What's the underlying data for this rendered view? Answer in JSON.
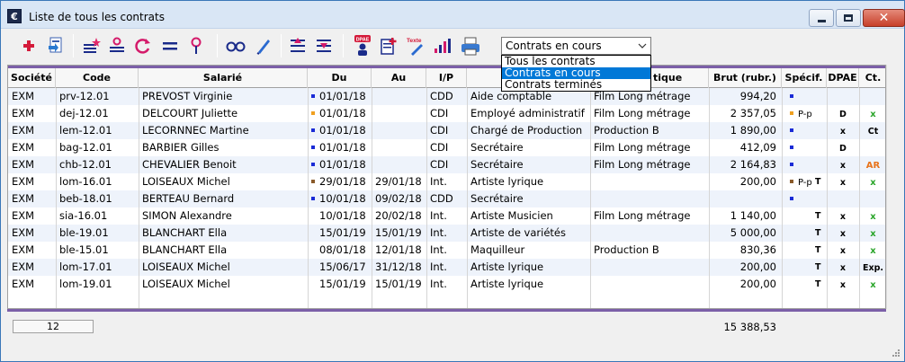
{
  "window": {
    "title": "Liste de tous les contrats",
    "app_icon": "€"
  },
  "filter": {
    "selected": "Contrats en cours",
    "options": [
      "Tous les contrats",
      "Contrats en cours",
      "Contrats terminés"
    ]
  },
  "toolbar": {
    "icons": [
      "add-icon",
      "import-icon",
      "list-star-icon",
      "list-people-icon",
      "refresh-icon",
      "equals-icon",
      "search-key-icon",
      "glasses-icon",
      "pen-icon",
      "sort-up-icon",
      "sort-down-icon",
      "dpae-icon",
      "new-doc-icon",
      "text-icon",
      "chart-icon",
      "print-icon"
    ],
    "dpae_label": "DPAE",
    "texte_label": "Texte"
  },
  "columns": [
    "Société",
    "Code",
    "Salarié",
    "Du",
    "Au",
    "I/P",
    "",
    "tique",
    "Brut (rubr.)",
    "Spécif.",
    "DPAE",
    "Ct."
  ],
  "rows": [
    {
      "societe": "EXM",
      "code": "prv-12.01",
      "salarie": "PREVOST Virginie",
      "mark": "#1a2bd6",
      "du": "01/01/18",
      "au": "",
      "ip": "CDD",
      "emploi": "Aide comptable",
      "prod": "Film Long métrage",
      "brut": "994,20",
      "spec_mark": "#1a2bd6",
      "spec": "",
      "spec_t": "",
      "dpae": "",
      "ct": "",
      "ct_class": ""
    },
    {
      "societe": "EXM",
      "code": "dej-12.01",
      "salarie": "DELCOURT Juliette",
      "mark": "#f0a020",
      "du": "01/01/18",
      "au": "",
      "ip": "CDI",
      "emploi": "Employé administratif",
      "prod": "Film Long métrage",
      "brut": "2 357,05",
      "spec_mark": "#f0a020",
      "spec": "P-p",
      "spec_t": "",
      "dpae": "D",
      "ct": "x",
      "ct_class": "green"
    },
    {
      "societe": "EXM",
      "code": "lem-12.01",
      "salarie": "LECORNNEC Martine",
      "mark": "#1a2bd6",
      "du": "01/01/18",
      "au": "",
      "ip": "CDI",
      "emploi": "Chargé de Production",
      "prod": "Production B",
      "brut": "1 890,00",
      "spec_mark": "#1a2bd6",
      "spec": "",
      "spec_t": "",
      "dpae": "x",
      "ct": "Ct",
      "ct_class": "bold"
    },
    {
      "societe": "EXM",
      "code": "bag-12.01",
      "salarie": "BARBIER Gilles",
      "mark": "#1a2bd6",
      "du": "01/01/18",
      "au": "",
      "ip": "CDI",
      "emploi": "Secrétaire",
      "prod": "Film Long métrage",
      "brut": "412,09",
      "spec_mark": "#1a2bd6",
      "spec": "",
      "spec_t": "",
      "dpae": "D",
      "ct": "",
      "ct_class": ""
    },
    {
      "societe": "EXM",
      "code": "chb-12.01",
      "salarie": "CHEVALIER Benoit",
      "mark": "#1a2bd6",
      "du": "01/01/18",
      "au": "",
      "ip": "CDI",
      "emploi": "Secrétaire",
      "prod": "Film Long métrage",
      "brut": "2 164,83",
      "spec_mark": "#1a2bd6",
      "spec": "",
      "spec_t": "",
      "dpae": "x",
      "ct": "AR",
      "ct_class": "orange"
    },
    {
      "societe": "EXM",
      "code": "lom-16.01",
      "salarie": "LOISEAUX Michel",
      "mark": "#8a5a2a",
      "du": "29/01/18",
      "au": "29/01/18",
      "ip": "Int.",
      "emploi": "Artiste lyrique",
      "prod": "",
      "brut": "200,00",
      "spec_mark": "#8a5a2a",
      "spec": "P-p",
      "spec_t": "T",
      "dpae": "x",
      "ct": "x",
      "ct_class": "green"
    },
    {
      "societe": "EXM",
      "code": "beb-18.01",
      "salarie": "BERTEAU Bernard",
      "mark": "#1a2bd6",
      "du": "10/01/18",
      "au": "09/02/18",
      "ip": "CDD",
      "emploi": "Secrétaire",
      "prod": "",
      "brut": "",
      "spec_mark": "#1a2bd6",
      "spec": "",
      "spec_t": "",
      "dpae": "",
      "ct": "",
      "ct_class": ""
    },
    {
      "societe": "EXM",
      "code": "sia-16.01",
      "salarie": "SIMON Alexandre",
      "mark": "",
      "du": "10/01/18",
      "au": "20/02/18",
      "ip": "Int.",
      "emploi": "Artiste Musicien",
      "prod": "Film Long métrage",
      "brut": "1 140,00",
      "spec_mark": "",
      "spec": "",
      "spec_t": "T",
      "dpae": "x",
      "ct": "x",
      "ct_class": "green"
    },
    {
      "societe": "EXM",
      "code": "ble-19.01",
      "salarie": "BLANCHART Ella",
      "mark": "",
      "du": "15/01/19",
      "au": "15/01/19",
      "ip": "Int.",
      "emploi": "Artiste de variétés",
      "prod": "",
      "brut": "5 000,00",
      "spec_mark": "",
      "spec": "",
      "spec_t": "T",
      "dpae": "x",
      "ct": "x",
      "ct_class": "green"
    },
    {
      "societe": "EXM",
      "code": "ble-15.01",
      "salarie": "BLANCHART Ella",
      "mark": "",
      "du": "08/01/18",
      "au": "12/01/18",
      "ip": "Int.",
      "emploi": "Maquilleur",
      "prod": "Production B",
      "brut": "830,36",
      "spec_mark": "",
      "spec": "",
      "spec_t": "T",
      "dpae": "x",
      "ct": "x",
      "ct_class": "green"
    },
    {
      "societe": "EXM",
      "code": "lom-17.01",
      "salarie": "LOISEAUX Michel",
      "mark": "",
      "du": "15/06/17",
      "au": "31/12/18",
      "ip": "Int.",
      "emploi": "Artiste lyrique",
      "prod": "",
      "brut": "200,00",
      "spec_mark": "",
      "spec": "",
      "spec_t": "T",
      "dpae": "x",
      "ct": "Exp.",
      "ct_class": "bold"
    },
    {
      "societe": "EXM",
      "code": "lom-19.01",
      "salarie": "LOISEAUX Michel",
      "mark": "",
      "du": "15/01/19",
      "au": "15/01/19",
      "ip": "Int.",
      "emploi": "Artiste lyrique",
      "prod": "",
      "brut": "200,00",
      "spec_mark": "",
      "spec": "",
      "spec_t": "T",
      "dpae": "x",
      "ct": "x",
      "ct_class": "green"
    }
  ],
  "footer": {
    "count": "12",
    "total": "15 388,53"
  }
}
